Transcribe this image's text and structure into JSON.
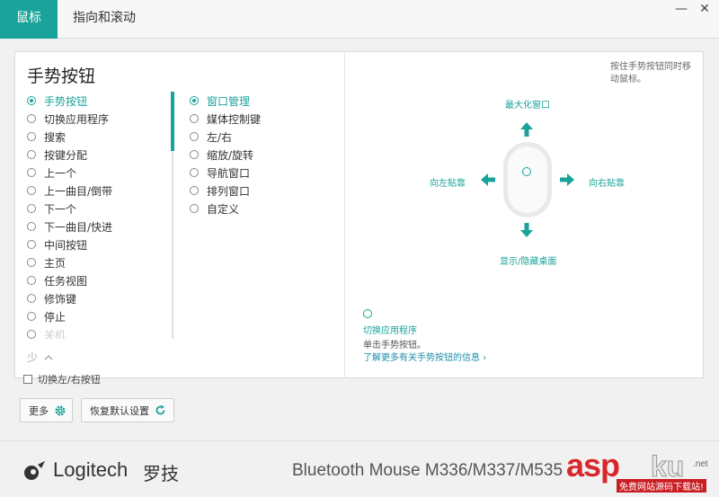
{
  "tabs": [
    {
      "label": "鼠标",
      "active": true
    },
    {
      "label": "指向和滚动",
      "active": false
    }
  ],
  "window_controls": {
    "minimize": "—",
    "close": "✕"
  },
  "section_title": "手势按钮",
  "button_list": [
    {
      "label": "手势按钮",
      "selected": true
    },
    {
      "label": "切换应用程序",
      "selected": false
    },
    {
      "label": "搜索",
      "selected": false
    },
    {
      "label": "按键分配",
      "selected": false
    },
    {
      "label": "上一个",
      "selected": false
    },
    {
      "label": "上一曲目/倒带",
      "selected": false
    },
    {
      "label": "下一个",
      "selected": false
    },
    {
      "label": "下一曲目/快进",
      "selected": false
    },
    {
      "label": "中间按钮",
      "selected": false
    },
    {
      "label": "主页",
      "selected": false
    },
    {
      "label": "任务视图",
      "selected": false
    },
    {
      "label": "修饰键",
      "selected": false
    },
    {
      "label": "停止",
      "selected": false
    },
    {
      "label": "关机",
      "selected": false
    }
  ],
  "gesture_list": [
    {
      "label": "窗口管理",
      "selected": true
    },
    {
      "label": "媒体控制键",
      "selected": false
    },
    {
      "label": "左/右",
      "selected": false
    },
    {
      "label": "缩放/旋转",
      "selected": false
    },
    {
      "label": "导航窗口",
      "selected": false
    },
    {
      "label": "排列窗口",
      "selected": false
    },
    {
      "label": "自定义",
      "selected": false
    }
  ],
  "less_toggle": "少",
  "hint_text": "按住手势按钮同时移动鼠标。",
  "directions": {
    "up": "最大化窗口",
    "left": "向左贴靠",
    "right": "向右贴靠",
    "down": "显示/隐藏桌面"
  },
  "gesture_info": {
    "title": "切换应用程序",
    "description": "单击手势按钮。",
    "link": "了解更多有关手势按钮的信息 ›"
  },
  "swap_buttons_label": "切换左/右按钮",
  "more_button": "更多",
  "reset_button": "恢复默认设置",
  "brand": {
    "name": "Logitech",
    "name_cn": "罗技"
  },
  "device_name": "Bluetooth Mouse M336/M337/M535",
  "watermark": {
    "main": "asp",
    "ku": "ku",
    "net": ".net",
    "sub": "免费网站源码下载站!"
  },
  "colors": {
    "accent": "#1aa39a",
    "link": "#1a8fa8",
    "watermark_red": "#d9262a"
  },
  "icons": {
    "more_button_icon": "gear-icon",
    "reset_button_icon": "reset-icon",
    "less_toggle_icon": "chevron-up-icon",
    "link_icon": "chevron-right-icon"
  }
}
